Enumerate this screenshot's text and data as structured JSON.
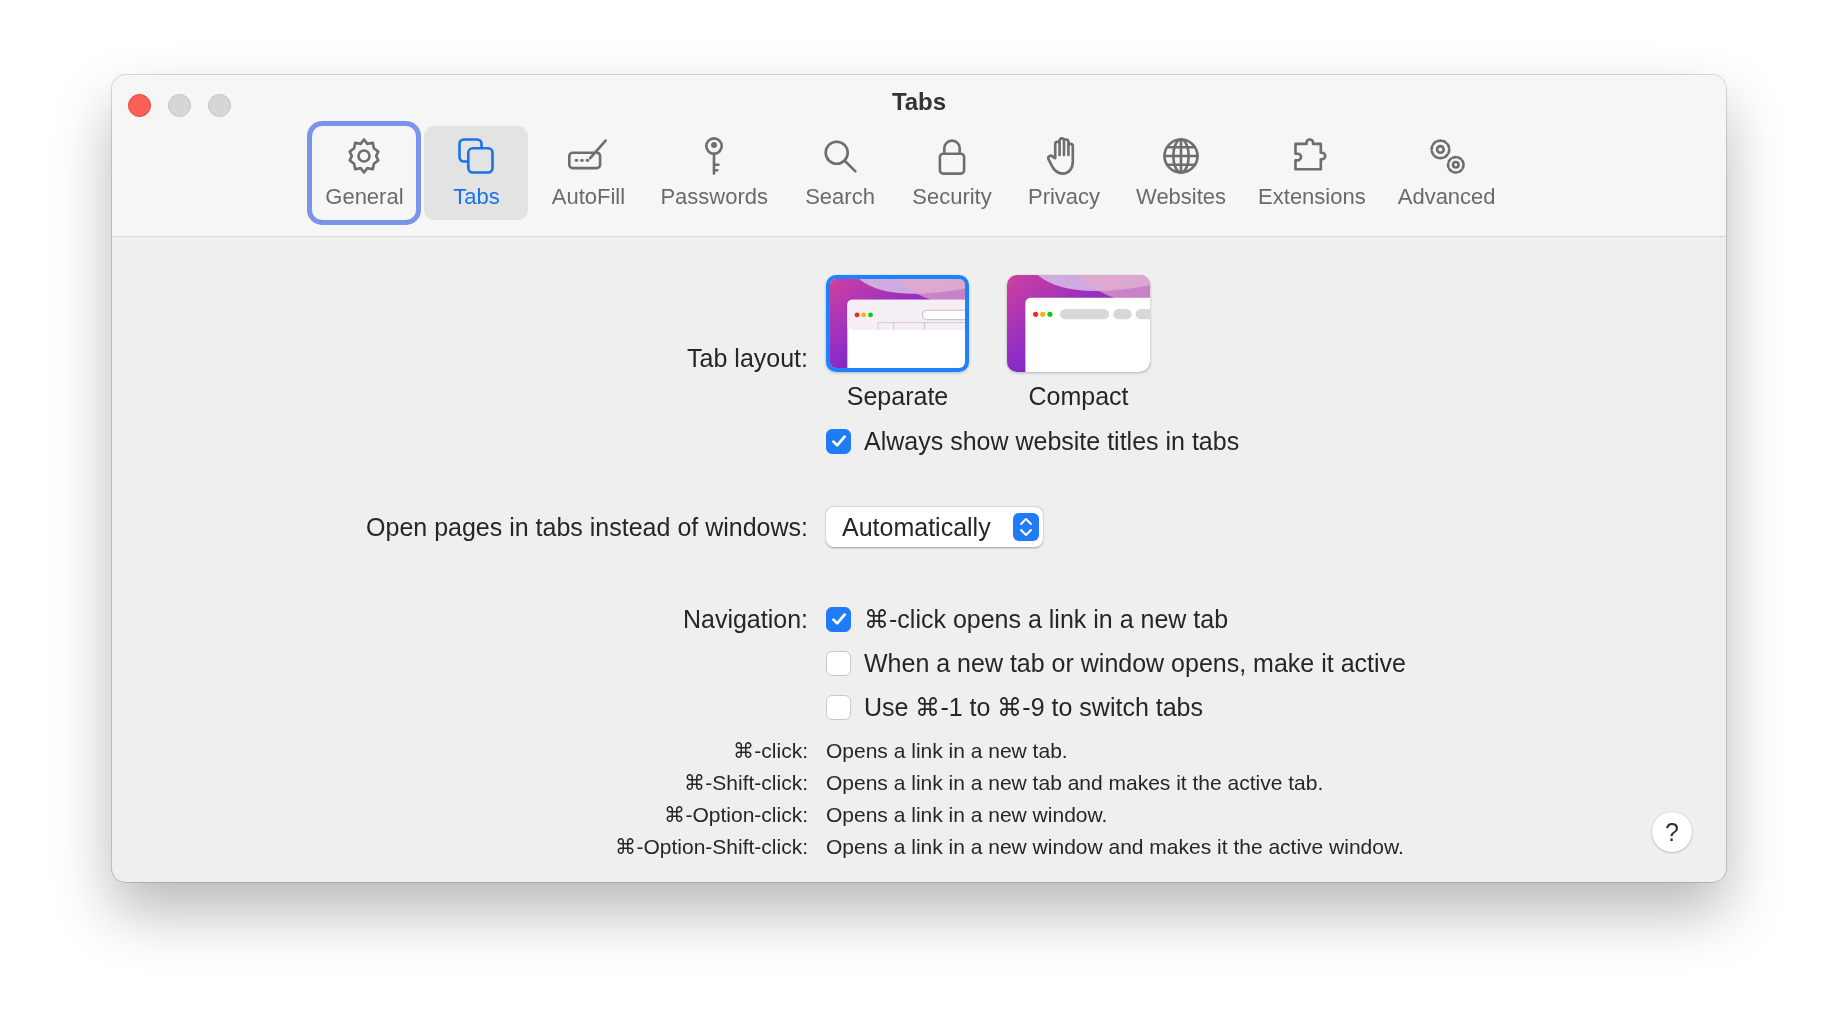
{
  "window": {
    "title": "Tabs"
  },
  "toolbar": [
    {
      "label": "General",
      "selected": false,
      "focused": true
    },
    {
      "label": "Tabs",
      "selected": true,
      "focused": false
    },
    {
      "label": "AutoFill",
      "selected": false,
      "focused": false
    },
    {
      "label": "Passwords",
      "selected": false,
      "focused": false
    },
    {
      "label": "Search",
      "selected": false,
      "focused": false
    },
    {
      "label": "Security",
      "selected": false,
      "focused": false
    },
    {
      "label": "Privacy",
      "selected": false,
      "focused": false
    },
    {
      "label": "Websites",
      "selected": false,
      "focused": false
    },
    {
      "label": "Extensions",
      "selected": false,
      "focused": false
    },
    {
      "label": "Advanced",
      "selected": false,
      "focused": false
    }
  ],
  "tab_layout": {
    "label": "Tab layout:",
    "options": [
      {
        "label": "Separate",
        "kind": "separate",
        "selected": true
      },
      {
        "label": "Compact",
        "kind": "compact",
        "selected": false
      }
    ],
    "checkbox": {
      "label": "Always show website titles in tabs",
      "checked": true
    }
  },
  "open_pages": {
    "label": "Open pages in tabs instead of windows:",
    "value": "Automatically"
  },
  "navigation": {
    "label": "Navigation:",
    "options": [
      {
        "label": "⌘-click opens a link in a new tab",
        "checked": true
      },
      {
        "label": "When a new tab or window opens, make it active",
        "checked": false
      },
      {
        "label": "Use ⌘-1 to ⌘-9 to switch tabs",
        "checked": false
      }
    ]
  },
  "shortcuts": [
    {
      "key": "⌘-click:",
      "description": "Opens a link in a new tab."
    },
    {
      "key": "⌘-Shift-click:",
      "description": "Opens a link in a new tab and makes it the active tab."
    },
    {
      "key": "⌘-Option-click:",
      "description": "Opens a link in a new window."
    },
    {
      "key": "⌘-Option-Shift-click:",
      "description": "Opens a link in a new window and makes it the active window."
    }
  ],
  "help_button": "?"
}
